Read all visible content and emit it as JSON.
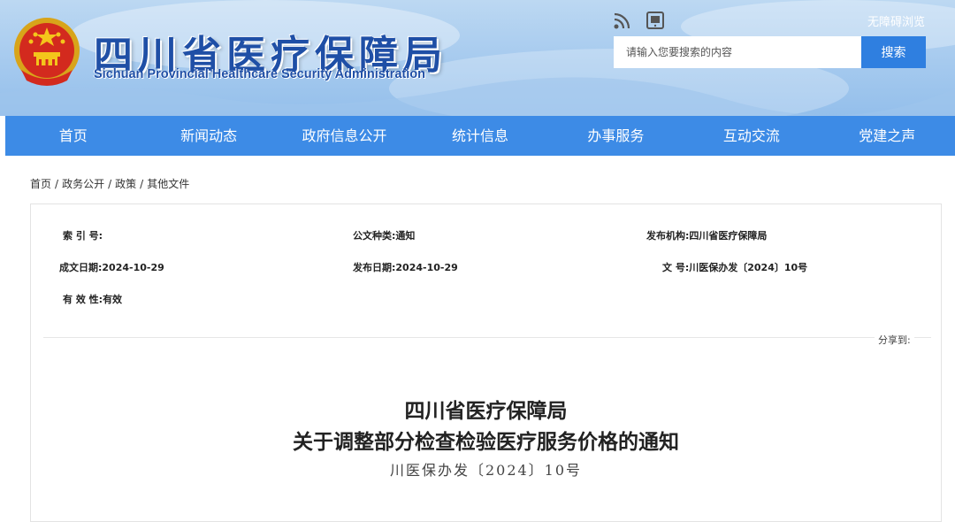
{
  "header": {
    "title_cn": "四川省医疗保障局",
    "title_en": "Sichuan Provincial Healthcare Security Administration",
    "accessible_link": "无障碍浏览",
    "rss_icon": "rss-icon",
    "mobile_icon": "tablet-icon",
    "emblem": "national-emblem"
  },
  "search": {
    "placeholder": "请输入您要搜索的内容",
    "button": "搜索"
  },
  "nav": {
    "items": [
      "首页",
      "新闻动态",
      "政府信息公开",
      "统计信息",
      "办事服务",
      "互动交流",
      "党建之声"
    ]
  },
  "breadcrumb": {
    "items": [
      "首页",
      "政务公开",
      "政策",
      "其他文件"
    ],
    "separator": "/"
  },
  "meta": {
    "index_label": "索 引 号:",
    "index_value": "",
    "type_label": "公文种类:",
    "type_value": "通知",
    "org_label": "发布机构:",
    "org_value": "四川省医疗保障局",
    "created_label": "成文日期:",
    "created_value": "2024-10-29",
    "published_label": "发布日期:",
    "published_value": "2024-10-29",
    "docno_label": "文 号:",
    "docno_value": "川医保办发〔2024〕10号",
    "valid_label": "有 效 性:",
    "valid_value": "有效",
    "share_label": "分享到:"
  },
  "document": {
    "title_line1": "四川省医疗保障局",
    "title_line2": "关于调整部分检查检验医疗服务价格的通知",
    "doc_number": "川医保办发〔2024〕10号"
  },
  "colors": {
    "nav_bg": "#3d8be6",
    "search_btn": "#2f7fe0",
    "title_blue": "#1f4fa6"
  }
}
